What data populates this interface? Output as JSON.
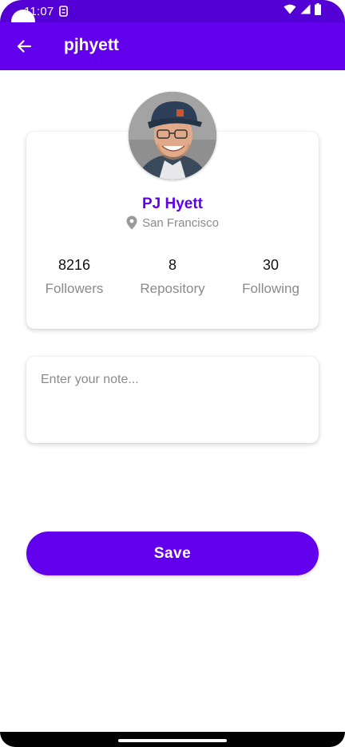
{
  "status_bar": {
    "time": "11:07",
    "notification_icon": "sync-icon",
    "icons": [
      "wifi-icon",
      "signal-icon",
      "battery-icon"
    ]
  },
  "app_bar": {
    "title": "pjhyett",
    "back_icon": "arrow-back-icon"
  },
  "profile": {
    "name": "PJ Hyett",
    "location": "San Francisco",
    "stats": [
      {
        "value": "8216",
        "label": "Followers"
      },
      {
        "value": "8",
        "label": "Repository"
      },
      {
        "value": "30",
        "label": "Following"
      }
    ]
  },
  "note": {
    "placeholder": "Enter your note...",
    "value": ""
  },
  "save_label": "Save",
  "colors": {
    "primary": "#6200ee",
    "status_bar": "#5200d4",
    "secondary_text": "#8a8a8a"
  }
}
